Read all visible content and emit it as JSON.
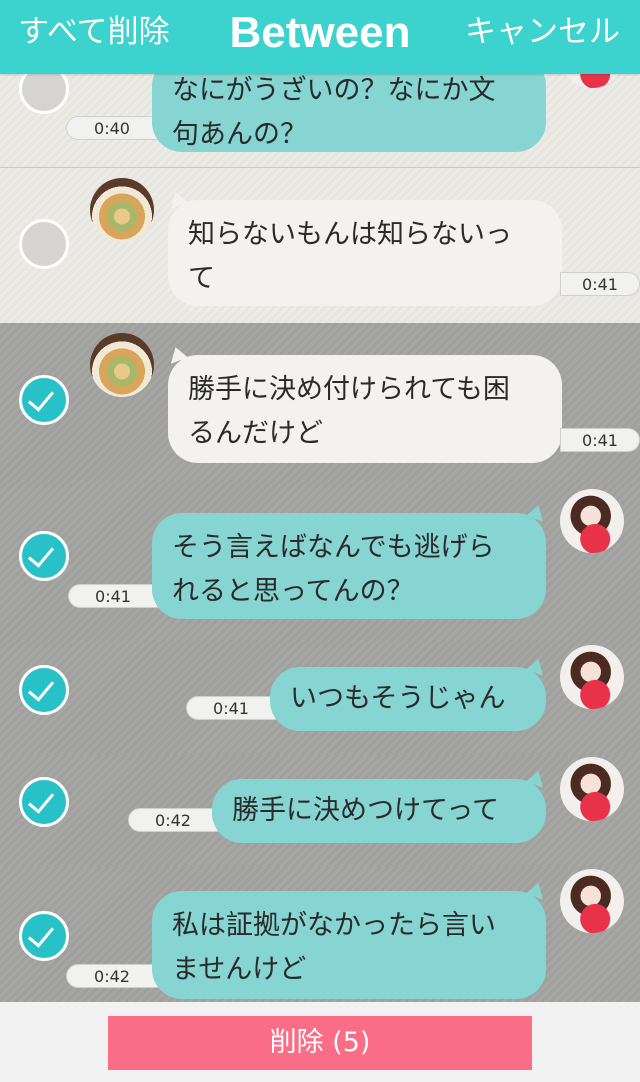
{
  "header": {
    "select_all": "すべて削除",
    "title": "Between",
    "cancel": "キャンセル"
  },
  "messages": [
    {
      "lines": [
        "なにがうざいの？なにか文",
        "句あんの？"
      ],
      "time": "0:40",
      "side": "right",
      "selected": false
    },
    {
      "lines": [
        "知らないもんは知らないっ",
        "て"
      ],
      "time": "0:41",
      "side": "left",
      "selected": false
    },
    {
      "lines": [
        "勝手に決め付けられても困",
        "るんだけど"
      ],
      "time": "0:41",
      "side": "left",
      "selected": true
    },
    {
      "lines": [
        "そう言えばなんでも逃げら",
        "れると思ってんの？"
      ],
      "time": "0:41",
      "side": "right",
      "selected": true
    },
    {
      "lines": [
        "いつもそうじゃん"
      ],
      "time": "0:41",
      "side": "right",
      "selected": true
    },
    {
      "lines": [
        "勝手に決めつけてって"
      ],
      "time": "0:42",
      "side": "right",
      "selected": true
    },
    {
      "lines": [
        "私は証拠がなかったら言い",
        "ませんけど"
      ],
      "time": "0:42",
      "side": "right",
      "selected": true
    }
  ],
  "footer": {
    "delete_label": "削除 (5)"
  },
  "colors": {
    "header": "#3cd2cd",
    "check": "#27c1c7",
    "bubble_right": "#86d5d3",
    "bubble_left": "#f3f2ee",
    "delete": "#fb6d86"
  }
}
